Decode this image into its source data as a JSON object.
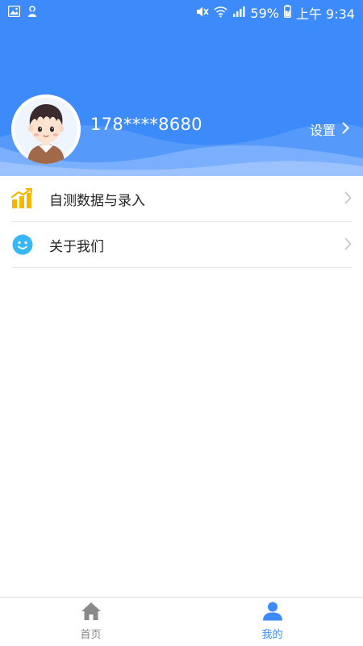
{
  "status_bar": {
    "battery": "59%",
    "time": "上午 9:34",
    "icons_left": [
      "image-icon",
      "notification-app-icon"
    ],
    "icons_right": [
      "mute-icon",
      "wifi-icon",
      "signal-icon",
      "battery-charging-icon"
    ]
  },
  "profile": {
    "phone": "178****8680",
    "settings_label": "设置",
    "avatar": "avatar-boy"
  },
  "menu": {
    "items": [
      {
        "label": "自测数据与录入",
        "icon": "chart-icon",
        "icon_color": "#f5b800"
      },
      {
        "label": "关于我们",
        "icon": "smile-icon",
        "icon_color": "#39b7f4"
      }
    ]
  },
  "bottom_nav": {
    "items": [
      {
        "label": "首页",
        "icon": "home-icon",
        "active": false
      },
      {
        "label": "我的",
        "icon": "user-icon",
        "active": true
      }
    ]
  },
  "colors": {
    "primary": "#3d8bfa",
    "inactive": "#8a8a8a",
    "divider": "#e5e5e5"
  }
}
